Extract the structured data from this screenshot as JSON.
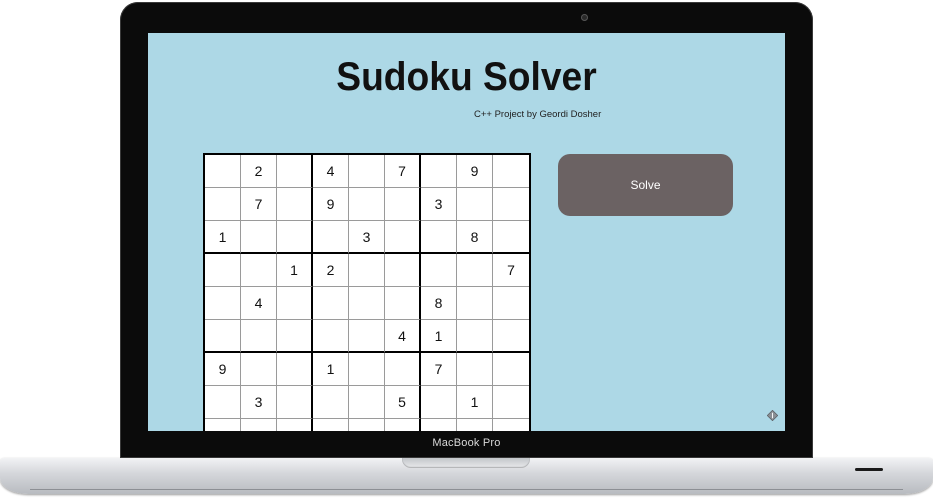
{
  "device": {
    "label": "MacBook Pro"
  },
  "app": {
    "title": "Sudoku Solver",
    "subtitle": "C++ Project by Geordi Dosher",
    "solve_label": "Solve",
    "background_color": "#add8e6",
    "button_color": "#6b6263"
  },
  "board": {
    "rows": [
      [
        "",
        "2",
        "",
        "4",
        "",
        "7",
        "",
        "9",
        ""
      ],
      [
        "",
        "7",
        "",
        "9",
        "",
        "",
        "3",
        "",
        ""
      ],
      [
        "1",
        "",
        "",
        "",
        "3",
        "",
        "",
        "8",
        ""
      ],
      [
        "",
        "",
        "1",
        "2",
        "",
        "",
        "",
        "",
        "7"
      ],
      [
        "",
        "4",
        "",
        "",
        "",
        "",
        "8",
        "",
        ""
      ],
      [
        "",
        "",
        "",
        "",
        "",
        "4",
        "1",
        "",
        ""
      ],
      [
        "9",
        "",
        "",
        "1",
        "",
        "",
        "7",
        "",
        ""
      ],
      [
        "",
        "3",
        "",
        "",
        "",
        "5",
        "",
        "1",
        ""
      ],
      [
        "",
        "",
        "",
        "",
        "",
        "",
        "",
        "",
        ""
      ]
    ]
  },
  "icons": {
    "corner": "settings-diamond-icon"
  }
}
